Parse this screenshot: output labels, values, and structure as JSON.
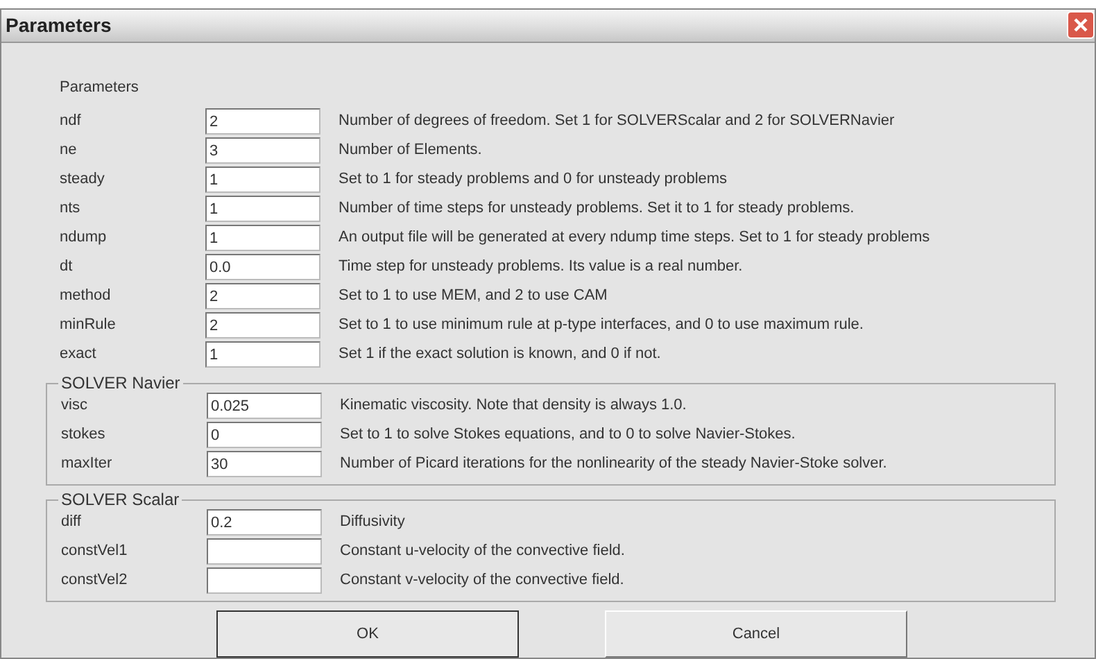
{
  "window": {
    "title": "Parameters"
  },
  "sections": [
    {
      "kind": "plain",
      "title": "Parameters",
      "rows": [
        {
          "name": "ndf",
          "value": "2",
          "description": "Number of degrees of freedom. Set 1 for SOLVERScalar and  2 for SOLVERNavier"
        },
        {
          "name": "ne",
          "value": "3",
          "description": "Number of Elements."
        },
        {
          "name": "steady",
          "value": "1",
          "description": "Set to 1 for steady problems and 0 for unsteady problems"
        },
        {
          "name": "nts",
          "value": "1",
          "description": "Number of time steps for unsteady problems. Set it to 1 for steady problems."
        },
        {
          "name": "ndump",
          "value": "1",
          "description": "An output file will be generated at every ndump time steps. Set to 1 for steady problems"
        },
        {
          "name": "dt",
          "value": "0.0",
          "description": "Time step for unsteady problems. Its value is a real number."
        },
        {
          "name": "method",
          "value": "2",
          "description": "Set to 1 to use MEM, and 2 to use CAM"
        },
        {
          "name": "minRule",
          "value": "2",
          "description": "Set to 1 to use minimum rule at p-type interfaces, and 0 to use maximum rule."
        },
        {
          "name": "exact",
          "value": "1",
          "description": "Set 1 if the exact solution is known, and 0 if not."
        }
      ]
    },
    {
      "kind": "group",
      "title": "SOLVER Navier",
      "rows": [
        {
          "name": "visc",
          "value": "0.025",
          "description": "Kinematic viscosity. Note that density is always 1.0."
        },
        {
          "name": "stokes",
          "value": "0",
          "description": "Set to 1 to solve Stokes equations, and to 0 to solve Navier-Stokes."
        },
        {
          "name": "maxIter",
          "value": "30",
          "description": "Number of Picard iterations for the nonlinearity of the steady Navier-Stoke solver."
        }
      ]
    },
    {
      "kind": "group",
      "title": "SOLVER Scalar",
      "rows": [
        {
          "name": "diff",
          "value": "0.2",
          "description": "Diffusivity"
        },
        {
          "name": "constVel1",
          "value": "",
          "description": "Constant u-velocity of the convective field."
        },
        {
          "name": "constVel2",
          "value": "",
          "description": "Constant v-velocity of the convective field."
        }
      ]
    }
  ],
  "buttons": [
    "OK",
    "Cancel"
  ]
}
